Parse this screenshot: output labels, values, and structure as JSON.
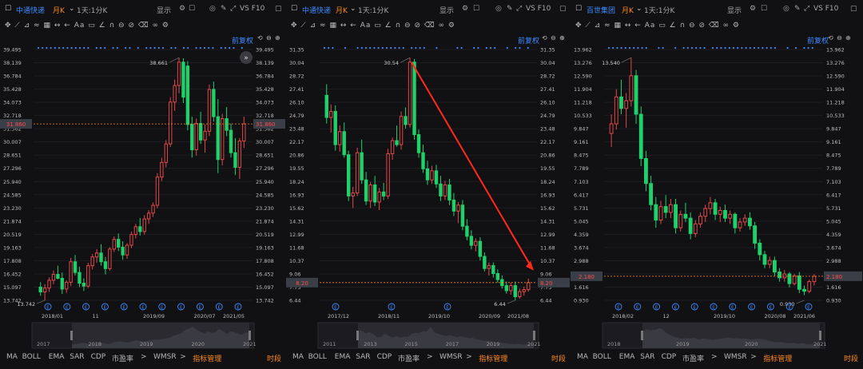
{
  "colors": {
    "up": "#e04848",
    "down": "#1fd06b",
    "price_line": "#ff8a1d",
    "accent": "#3d8bff",
    "arrow": "#ff2a1a",
    "bg": "#111114"
  },
  "toolbar": {
    "display_label": "显示",
    "vs_label": "VS F10",
    "fq_label": "前复权",
    "tool_icons": [
      "move-icon",
      "draw-line-icon",
      "draw-channel-icon",
      "draw-wave-icon",
      "grid-icon",
      "range-icon",
      "arrow-icon",
      "text-icon",
      "comment-icon",
      "angle-icon",
      "magnet-icon",
      "eye-icon",
      "clear-icon",
      "delete-icon",
      "link-icon",
      "settings-icon"
    ]
  },
  "bottom_tabs": [
    "MA",
    "BOLL",
    "EMA",
    "SAR",
    "CDP",
    "市盈率",
    ">",
    "WMSR",
    ">",
    "指标管理"
  ],
  "period_tab": "时段",
  "panels": [
    {
      "stock": "中通快递",
      "period": "月K",
      "interval": "1天:1分K",
      "y_ticks": [
        "39.495",
        "38.139",
        "36.784",
        "35.428",
        "34.073",
        "32.718",
        "31.362",
        "30.007",
        "28.651",
        "27.296",
        "25.940",
        "24.585",
        "23.230",
        "21.874",
        "20.519",
        "19.163",
        "17.808",
        "16.452",
        "15.097",
        "13.742"
      ],
      "y_min": 13.742,
      "y_max": 39.495,
      "current_price": "31.860",
      "current_value": 31.86,
      "high_label": "38.661",
      "high_value": 38.661,
      "low_label": "13.742",
      "low_value": 13.742,
      "x_labels": [
        "2018/01",
        "11",
        "2019/09",
        "2020/07",
        "2021/05"
      ],
      "nav_years": [
        "2017",
        "2018",
        "2019",
        "2020",
        "2021"
      ],
      "chart_data": {
        "type": "candlestick",
        "ohlc": [
          [
            15.1,
            15.6,
            14.2,
            14.6
          ],
          [
            14.6,
            15.4,
            13.742,
            15.0
          ],
          [
            15.0,
            16.1,
            14.6,
            15.8
          ],
          [
            15.8,
            16.8,
            15.4,
            16.4
          ],
          [
            16.4,
            17.3,
            15.9,
            16.0
          ],
          [
            16.0,
            16.6,
            14.4,
            14.9
          ],
          [
            14.9,
            15.8,
            14.5,
            15.6
          ],
          [
            15.6,
            18.1,
            15.2,
            17.7
          ],
          [
            17.7,
            18.4,
            16.3,
            16.6
          ],
          [
            16.6,
            17.2,
            15.1,
            15.5
          ],
          [
            15.5,
            16.0,
            14.7,
            15.2
          ],
          [
            15.2,
            17.6,
            15.0,
            17.3
          ],
          [
            17.3,
            18.5,
            16.9,
            18.2
          ],
          [
            18.2,
            19.0,
            17.6,
            18.6
          ],
          [
            18.6,
            19.5,
            17.3,
            17.7
          ],
          [
            17.7,
            18.2,
            16.4,
            17.0
          ],
          [
            17.0,
            19.2,
            16.8,
            19.0
          ],
          [
            19.0,
            20.3,
            18.7,
            20.0
          ],
          [
            20.0,
            20.6,
            18.8,
            19.2
          ],
          [
            19.2,
            19.8,
            17.9,
            18.4
          ],
          [
            18.4,
            19.6,
            18.0,
            19.4
          ],
          [
            19.4,
            20.8,
            19.1,
            20.5
          ],
          [
            20.5,
            21.6,
            20.1,
            21.3
          ],
          [
            21.3,
            22.2,
            20.4,
            20.8
          ],
          [
            20.8,
            22.5,
            20.5,
            22.1
          ],
          [
            22.1,
            23.0,
            21.6,
            22.7
          ],
          [
            22.7,
            23.8,
            22.3,
            23.5
          ],
          [
            23.5,
            26.8,
            23.2,
            26.4
          ],
          [
            26.4,
            28.4,
            26.0,
            27.9
          ],
          [
            27.9,
            30.2,
            27.4,
            29.8
          ],
          [
            29.8,
            34.6,
            29.5,
            34.1
          ],
          [
            34.1,
            36.4,
            33.2,
            35.8
          ],
          [
            35.8,
            38.661,
            35.0,
            38.2
          ],
          [
            38.2,
            38.6,
            34.0,
            34.6
          ],
          [
            37.8,
            38.3,
            31.2,
            31.8
          ],
          [
            31.8,
            32.6,
            28.4,
            29.2
          ],
          [
            29.2,
            32.4,
            28.6,
            31.9
          ],
          [
            31.9,
            33.1,
            29.8,
            30.2
          ],
          [
            30.2,
            31.8,
            28.9,
            31.1
          ],
          [
            31.1,
            35.9,
            30.6,
            35.4
          ],
          [
            35.4,
            36.2,
            32.1,
            32.6
          ],
          [
            32.6,
            34.4,
            26.8,
            28.2
          ],
          [
            28.2,
            32.9,
            27.6,
            32.4
          ],
          [
            32.4,
            33.6,
            30.6,
            31.2
          ],
          [
            31.2,
            31.9,
            28.4,
            28.9
          ],
          [
            28.9,
            30.4,
            26.6,
            27.4
          ],
          [
            27.4,
            30.4,
            26.2,
            30.1
          ],
          [
            30.1,
            32.6,
            29.4,
            31.86
          ]
        ]
      }
    },
    {
      "stock": "中通快递",
      "period": "月K",
      "interval": "1天:1分K",
      "y_ticks": [
        "31.35",
        "30.04",
        "28.72",
        "27.41",
        "26.10",
        "24.79",
        "23.48",
        "22.17",
        "20.86",
        "19.55",
        "18.24",
        "16.93",
        "15.62",
        "14.31",
        "12.99",
        "11.68",
        "10.37",
        "9.06",
        "7.75",
        "6.44"
      ],
      "y_min": 6.44,
      "y_max": 31.35,
      "current_price": "8.20",
      "current_value": 8.2,
      "high_label": "30.54",
      "high_value": 30.54,
      "low_label": "6.44",
      "low_value": 6.44,
      "x_labels": [
        "2017/12",
        "2018/11",
        "2019/10",
        "2020/09",
        "2021/08"
      ],
      "nav_years": [
        "2011",
        "2013",
        "2015",
        "2017",
        "2019",
        "2021"
      ],
      "chart_data": {
        "type": "candlestick",
        "ohlc": [
          [
            26.8,
            27.9,
            24.0,
            24.6
          ],
          [
            24.6,
            25.9,
            23.1,
            25.2
          ],
          [
            25.2,
            25.8,
            21.3,
            21.9
          ],
          [
            21.9,
            23.8,
            21.2,
            23.2
          ],
          [
            23.2,
            24.1,
            20.6,
            20.9
          ],
          [
            20.9,
            21.3,
            16.3,
            16.8
          ],
          [
            16.8,
            17.7,
            15.6,
            17.1
          ],
          [
            17.1,
            21.6,
            16.8,
            21.1
          ],
          [
            21.1,
            22.4,
            18.0,
            18.4
          ],
          [
            18.4,
            19.2,
            15.9,
            16.3
          ],
          [
            16.3,
            18.2,
            15.6,
            17.9
          ],
          [
            17.9,
            18.8,
            15.8,
            16.2
          ],
          [
            16.2,
            17.6,
            15.4,
            17.2
          ],
          [
            17.2,
            18.1,
            16.4,
            16.8
          ],
          [
            16.8,
            21.5,
            16.5,
            21.0
          ],
          [
            21.0,
            22.6,
            20.4,
            22.3
          ],
          [
            22.3,
            23.8,
            21.7,
            21.9
          ],
          [
            21.9,
            25.2,
            21.4,
            24.7
          ],
          [
            24.7,
            25.6,
            23.5,
            23.9
          ],
          [
            23.9,
            30.54,
            23.6,
            30.1
          ],
          [
            30.1,
            30.4,
            22.4,
            22.9
          ],
          [
            22.9,
            23.4,
            20.6,
            21.1
          ],
          [
            21.1,
            21.9,
            19.1,
            19.5
          ],
          [
            19.5,
            20.3,
            17.9,
            18.4
          ],
          [
            18.4,
            19.8,
            18.0,
            19.3
          ],
          [
            19.3,
            19.9,
            17.6,
            18.0
          ],
          [
            18.0,
            18.8,
            16.3,
            16.8
          ],
          [
            16.8,
            18.3,
            16.4,
            17.9
          ],
          [
            17.9,
            18.5,
            15.9,
            16.4
          ],
          [
            16.4,
            17.1,
            14.8,
            15.3
          ],
          [
            15.3,
            16.2,
            14.1,
            15.9
          ],
          [
            15.9,
            16.4,
            13.4,
            13.8
          ],
          [
            13.8,
            14.5,
            12.4,
            12.8
          ],
          [
            12.8,
            13.4,
            11.5,
            11.9
          ],
          [
            11.9,
            12.6,
            11.3,
            12.3
          ],
          [
            12.3,
            12.7,
            10.4,
            10.8
          ],
          [
            10.8,
            11.2,
            9.3,
            9.6
          ],
          [
            9.6,
            10.2,
            8.9,
            9.9
          ],
          [
            9.9,
            10.2,
            8.7,
            9.1
          ],
          [
            9.1,
            9.5,
            8.2,
            8.5
          ],
          [
            8.5,
            8.9,
            7.6,
            7.9
          ],
          [
            7.9,
            8.3,
            7.1,
            7.4
          ],
          [
            7.4,
            8.2,
            7.0,
            7.9
          ],
          [
            7.9,
            8.3,
            6.44,
            6.8
          ],
          [
            6.8,
            7.6,
            6.6,
            7.3
          ],
          [
            7.3,
            7.8,
            6.9,
            7.5
          ],
          [
            7.5,
            8.6,
            7.3,
            8.2
          ]
        ]
      }
    },
    {
      "stock": "百世集团",
      "period": "月K",
      "interval": "1天:1分K",
      "y_ticks": [
        "13.962",
        "13.276",
        "12.590",
        "11.904",
        "11.218",
        "10.533",
        "9.847",
        "9.161",
        "8.475",
        "7.789",
        "7.103",
        "6.417",
        "5.731",
        "5.045",
        "4.359",
        "3.674",
        "2.988",
        "2.302",
        "1.616",
        "0.930"
      ],
      "y_min": 0.93,
      "y_max": 13.962,
      "current_price": "2.180",
      "current_value": 2.18,
      "high_label": "13.540",
      "high_value": 13.54,
      "low_label": "0.930",
      "low_value": 0.93,
      "x_labels": [
        "2018/02",
        "12",
        "2019/10",
        "2020/08",
        "2021/06"
      ],
      "nav_years": [
        "2018",
        "2019",
        "2020",
        "2021"
      ],
      "chart_data": {
        "type": "candlestick",
        "ohlc": [
          [
            9.6,
            10.6,
            8.9,
            10.1
          ],
          [
            10.1,
            11.9,
            9.8,
            11.5
          ],
          [
            11.5,
            12.4,
            10.6,
            10.9
          ],
          [
            10.9,
            11.7,
            9.9,
            11.3
          ],
          [
            11.3,
            13.54,
            11.0,
            12.6
          ],
          [
            12.6,
            12.9,
            10.1,
            10.6
          ],
          [
            10.6,
            11.0,
            7.9,
            8.3
          ],
          [
            8.3,
            8.7,
            6.6,
            7.0
          ],
          [
            7.0,
            7.4,
            5.6,
            5.9
          ],
          [
            5.9,
            6.3,
            4.7,
            5.1
          ],
          [
            5.1,
            6.1,
            4.9,
            5.8
          ],
          [
            5.8,
            6.4,
            5.2,
            5.5
          ],
          [
            5.5,
            6.2,
            5.2,
            5.9
          ],
          [
            5.9,
            6.2,
            4.4,
            4.7
          ],
          [
            4.7,
            5.6,
            4.5,
            5.4
          ],
          [
            5.4,
            6.0,
            5.0,
            5.2
          ],
          [
            5.2,
            5.5,
            4.1,
            4.4
          ],
          [
            4.4,
            5.1,
            4.2,
            4.9
          ],
          [
            4.9,
            5.5,
            4.7,
            5.3
          ],
          [
            5.3,
            5.9,
            5.0,
            5.7
          ],
          [
            5.7,
            6.3,
            5.4,
            6.0
          ],
          [
            6.0,
            6.2,
            5.1,
            5.4
          ],
          [
            5.4,
            5.8,
            5.0,
            5.6
          ],
          [
            5.6,
            5.9,
            5.0,
            5.2
          ],
          [
            5.2,
            5.6,
            4.9,
            5.4
          ],
          [
            5.4,
            5.5,
            4.4,
            4.7
          ],
          [
            4.7,
            5.2,
            4.5,
            5.0
          ],
          [
            5.0,
            5.4,
            4.8,
            5.2
          ],
          [
            5.2,
            5.5,
            4.6,
            4.8
          ],
          [
            4.8,
            5.0,
            3.6,
            3.9
          ],
          [
            3.9,
            4.1,
            3.0,
            3.3
          ],
          [
            3.3,
            3.5,
            2.6,
            2.8
          ],
          [
            2.8,
            3.2,
            2.6,
            3.0
          ],
          [
            3.0,
            3.2,
            2.2,
            2.4
          ],
          [
            2.4,
            2.6,
            1.9,
            2.1
          ],
          [
            2.1,
            2.5,
            1.9,
            2.3
          ],
          [
            2.3,
            2.4,
            1.6,
            1.8
          ],
          [
            1.8,
            2.3,
            1.7,
            2.2
          ],
          [
            2.2,
            2.4,
            1.3,
            1.5
          ],
          [
            1.5,
            1.7,
            1.2,
            1.4
          ],
          [
            1.4,
            2.0,
            1.3,
            1.9
          ],
          [
            1.9,
            2.3,
            1.7,
            2.18
          ]
        ]
      }
    }
  ]
}
